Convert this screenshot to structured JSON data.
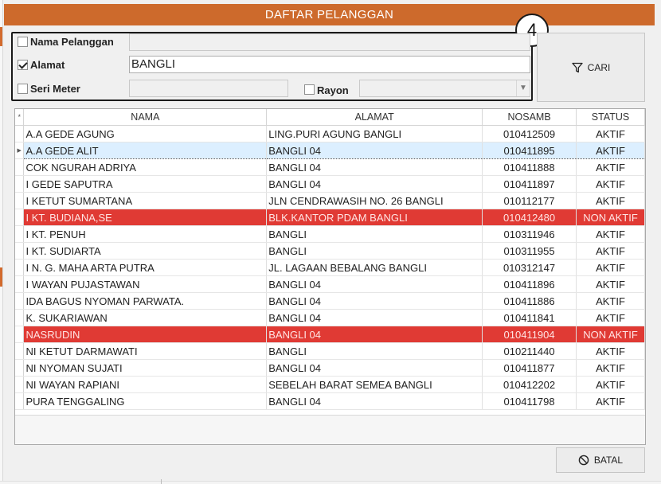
{
  "window": {
    "title": "DAFTAR PELANGGAN"
  },
  "filters": {
    "badge_number": "4",
    "nama_pelanggan": {
      "label": "Nama Pelanggan",
      "checked": false,
      "value": ""
    },
    "alamat": {
      "label": "Alamat",
      "checked": true,
      "value": "BANGLI"
    },
    "seri_meter": {
      "label": "Seri Meter",
      "checked": false,
      "value": ""
    },
    "rayon": {
      "label": "Rayon",
      "checked": false,
      "value": ""
    }
  },
  "buttons": {
    "cari_label": "CARI",
    "batal_label": "BATAL"
  },
  "grid": {
    "corner_symbol": "*",
    "columns": [
      "NAMA",
      "ALAMAT",
      "NOSAMB",
      "STATUS"
    ],
    "current_row_index": 1,
    "inactive_color": "#e03a34",
    "selected_color": "#dcefff",
    "rows": [
      {
        "nama": "A.A GEDE AGUNG",
        "alamat": "LING.PURI AGUNG BANGLI",
        "nosamb": "010412509",
        "status": "AKTIF"
      },
      {
        "nama": "A.A GEDE ALIT",
        "alamat": "BANGLI 04",
        "nosamb": "010411895",
        "status": "AKTIF"
      },
      {
        "nama": "COK NGURAH ADRIYA",
        "alamat": "BANGLI 04",
        "nosamb": "010411888",
        "status": "AKTIF"
      },
      {
        "nama": "I GEDE SAPUTRA",
        "alamat": "BANGLI 04",
        "nosamb": "010411897",
        "status": "AKTIF"
      },
      {
        "nama": "I KETUT SUMARTANA",
        "alamat": "JLN CENDRAWASIH NO. 26 BANGLI",
        "nosamb": "010112177",
        "status": "AKTIF"
      },
      {
        "nama": "I KT. BUDIANA,SE",
        "alamat": "BLK.KANTOR PDAM BANGLI",
        "nosamb": "010412480",
        "status": "NON AKTIF"
      },
      {
        "nama": "I KT. PENUH",
        "alamat": "BANGLI",
        "nosamb": "010311946",
        "status": "AKTIF"
      },
      {
        "nama": "I KT. SUDIARTA",
        "alamat": "BANGLI",
        "nosamb": "010311955",
        "status": "AKTIF"
      },
      {
        "nama": "I N. G. MAHA ARTA PUTRA",
        "alamat": "JL. LAGAAN BEBALANG BANGLI",
        "nosamb": "010312147",
        "status": "AKTIF"
      },
      {
        "nama": "I WAYAN PUJASTAWAN",
        "alamat": "BANGLI 04",
        "nosamb": "010411896",
        "status": "AKTIF"
      },
      {
        "nama": "IDA BAGUS NYOMAN PARWATA.",
        "alamat": "BANGLI 04",
        "nosamb": "010411886",
        "status": "AKTIF"
      },
      {
        "nama": "K. SUKARIAWAN",
        "alamat": "BANGLI 04",
        "nosamb": "010411841",
        "status": "AKTIF"
      },
      {
        "nama": "NASRUDIN",
        "alamat": "BANGLI 04",
        "nosamb": "010411904",
        "status": "NON AKTIF"
      },
      {
        "nama": "NI KETUT DARMAWATI",
        "alamat": "BANGLI",
        "nosamb": "010211440",
        "status": "AKTIF"
      },
      {
        "nama": "NI NYOMAN SUJATI",
        "alamat": "BANGLI 04",
        "nosamb": "010411877",
        "status": "AKTIF"
      },
      {
        "nama": "NI WAYAN RAPIANI",
        "alamat": "SEBELAH BARAT SEMEA BANGLI",
        "nosamb": "010412202",
        "status": "AKTIF"
      },
      {
        "nama": "PURA TENGGALING",
        "alamat": "BANGLI 04",
        "nosamb": "010411798",
        "status": "AKTIF"
      }
    ]
  }
}
